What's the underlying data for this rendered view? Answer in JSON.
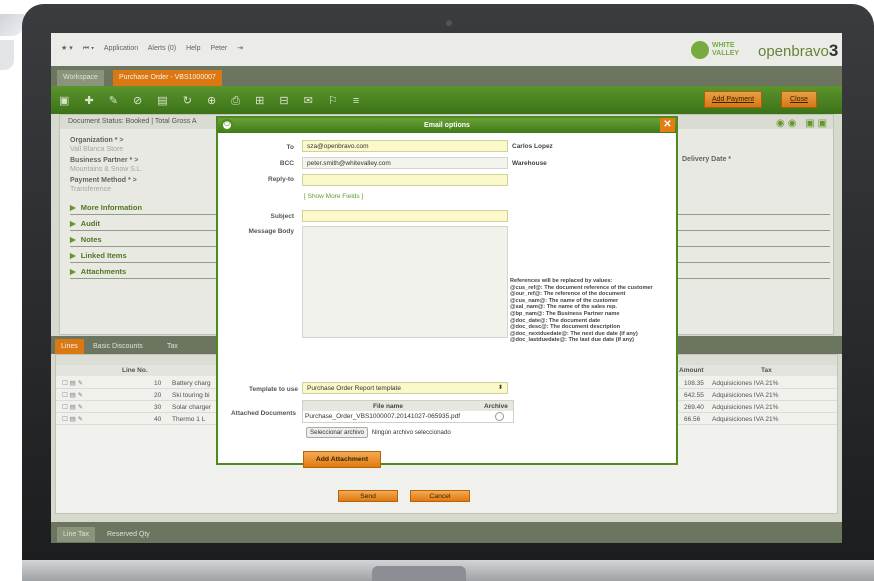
{
  "topnav": {
    "menu": [
      "Application",
      "Alerts (0)",
      "Help",
      "Peter"
    ],
    "logo_ww": "WHITE VALLEY",
    "logo_ob": "openbravo",
    "logo_ob_version": "3"
  },
  "tabs": [
    "Workspace",
    "Purchase Order - VBS1000007"
  ],
  "toolbar": {
    "add_payment": "Add Payment",
    "close": "Close"
  },
  "form": {
    "doc_status": "Document Status: Booked | Total Gross A",
    "fields": [
      {
        "label": "Organization * >",
        "value": "Vall Blanca Store"
      },
      {
        "label": "Business Partner * >",
        "value": "Mountains & Snow S.L."
      },
      {
        "label": "Payment Method * >",
        "value": "Transference"
      }
    ],
    "right_label": "Delivery Date *",
    "sections": [
      "More Information",
      "Audit",
      "Notes",
      "Linked Items",
      "Attachments"
    ]
  },
  "lines": {
    "tabs": [
      "Lines",
      "Basic Discounts",
      "Tax"
    ],
    "col_line_no": "Line No.",
    "col_amount": "Amount",
    "col_tax": "Tax",
    "rows": [
      {
        "no": "10",
        "product": "Battery charg",
        "amount": "108.35",
        "tax": "Adquisiciones IVA 21%"
      },
      {
        "no": "20",
        "product": "Ski touring bi",
        "amount": "642.55",
        "tax": "Adquisiciones IVA 21%"
      },
      {
        "no": "30",
        "product": "Solar charger",
        "amount": "269.40",
        "tax": "Adquisiciones IVA 21%"
      },
      {
        "no": "40",
        "product": "Thermo 1 L",
        "amount": "66.56",
        "tax": "Adquisiciones IVA 21%"
      }
    ],
    "bottom_tabs": [
      "Line Tax",
      "Reserved Qty"
    ]
  },
  "modal": {
    "title": "Email options",
    "to_label": "To",
    "to_value": "sza@openbravo.com",
    "to_name": "Carlos Lopez",
    "bcc_label": "BCC",
    "bcc_value": "peter.smith@whitevalley.com",
    "bcc_name": "Warehouse",
    "reply_label": "Reply-to",
    "reply_value": "",
    "show_more": "[ Show More Fields ]",
    "subject_label": "Subject",
    "subject_value": "",
    "body_label": "Message Body",
    "references": [
      "References will be replaced by values:",
      "@cus_ref@: The document reference of the customer",
      "@our_ref@: The reference of the document",
      "@cus_nam@: The name of the customer",
      "@sal_nam@: The name of the sales rep.",
      "@bp_nam@: The Business Partner name",
      "@doc_date@: The document date",
      "@doc_desc@: The document description",
      "@doc_nextduedate@: The next due date (if any)",
      "@doc_lastduedate@: The last due date (if any)"
    ],
    "template_label": "Template to use",
    "template_value": "Purchase Order Report template",
    "attached_label": "Attached Documents",
    "col_file": "File name",
    "col_archive": "Archive",
    "file_name": "Purchase_Order_VBS1000007.20141027-065935.pdf",
    "file_button": "Seleccionar archivo",
    "file_none": "Ningún archivo seleccionado",
    "add_attachment": "Add Attachment",
    "send": "Send",
    "cancel": "Cancel"
  }
}
